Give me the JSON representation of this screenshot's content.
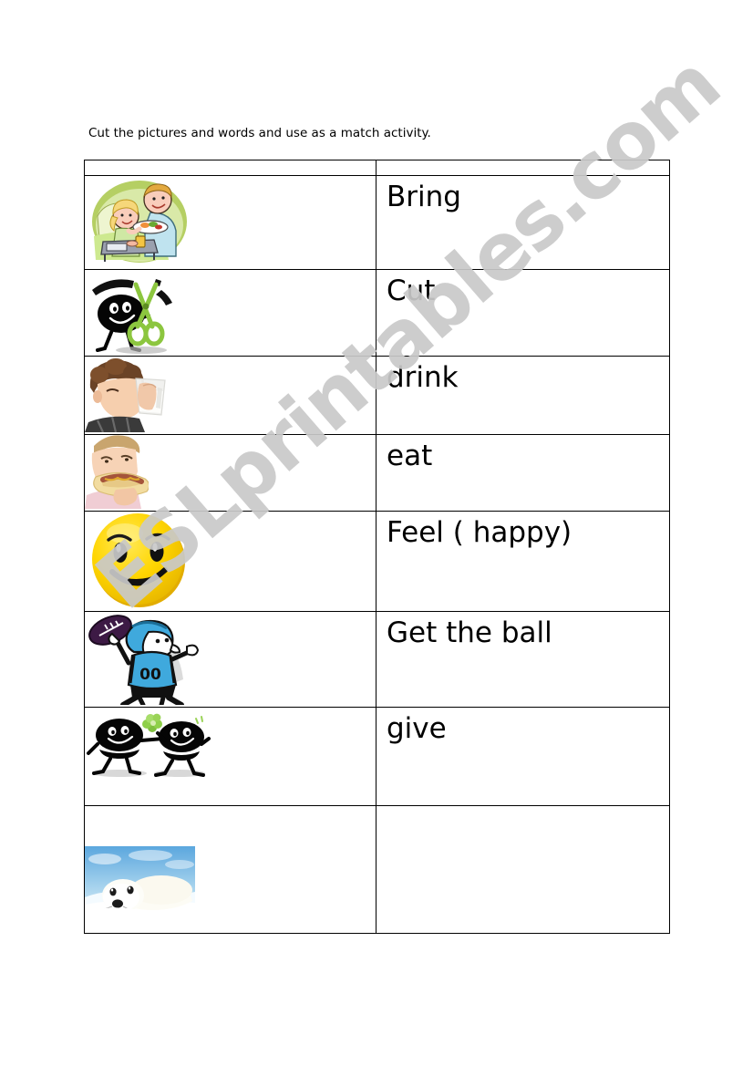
{
  "document": {
    "instruction": "Cut the pictures and words and use as a match activity.",
    "watermark": "ESLprintables.com"
  },
  "table": {
    "header_row": {
      "picture_header": "",
      "word_header": ""
    },
    "rows": [
      {
        "word": "Bring",
        "picture_name": "bring-breakfast-in-bed-clipart",
        "picture_alt": "Cartoon of a man bringing a breakfast tray to a woman in bed"
      },
      {
        "word": "Cut",
        "picture_name": "cut-scissors-clipart",
        "picture_alt": "Black cartoon character cutting with green scissors"
      },
      {
        "word": "drink",
        "picture_name": "drink-milk-photo",
        "picture_alt": "Photo of a boy drinking a glass of milk"
      },
      {
        "word": "eat",
        "picture_name": "eat-hotdog-photo",
        "picture_alt": "Photo of a child eating a hot dog"
      },
      {
        "word": "Feel ( happy)",
        "picture_name": "happy-smiley-face",
        "picture_alt": "Yellow smiley face with eyebrows and a smile"
      },
      {
        "word": "Get the ball",
        "picture_name": "football-player-catching-ball-clipart",
        "picture_alt": "Cartoon football player in a blue jersey numbered 00 catching a football"
      },
      {
        "word": "give",
        "picture_name": "give-flower-clipart",
        "picture_alt": "Two black cartoon characters, one giving a green flower to the other"
      },
      {
        "word": "",
        "picture_name": "baby-seal-photo",
        "picture_alt": "Photo of a white baby harp seal lying on snow"
      }
    ]
  },
  "colors": {
    "ink": "#000000",
    "paper": "#ffffff",
    "watermark": "#c9c9c9",
    "smiley_yellow": "#ffd500",
    "jersey_blue": "#3fa9dd",
    "football_purple": "#3d1a45",
    "scissors_green": "#8cc63f",
    "seal_sky": "#8ec6ea"
  }
}
